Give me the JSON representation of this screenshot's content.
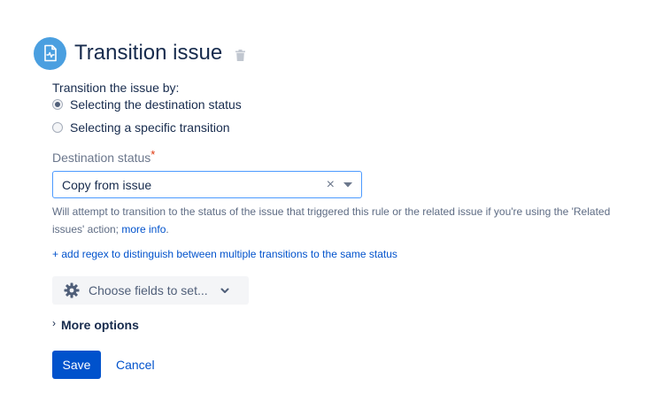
{
  "header": {
    "title": "Transition issue",
    "icon": "issue-transition-icon",
    "delete_icon": "trash-icon",
    "icon_color": "#4a9fe0"
  },
  "transition_by": {
    "label": "Transition the issue by:",
    "options": [
      {
        "label": "Selecting the destination status",
        "selected": true
      },
      {
        "label": "Selecting a specific transition",
        "selected": false
      }
    ]
  },
  "destination": {
    "label": "Destination status",
    "required_mark": "*",
    "value": "Copy from issue",
    "clear_icon": "×",
    "helper_text": "Will attempt to transition to the status of the issue that triggered this rule or the related issue if you're using the 'Related issues' action;",
    "helper_link": "more info",
    "helper_end": "."
  },
  "regex_link": "+ add regex to distinguish between multiple transitions to the same status",
  "fields_button": {
    "label": "Choose fields to set...",
    "icon": "gear-icon"
  },
  "more_options": {
    "label": "More options"
  },
  "actions": {
    "save": "Save",
    "cancel": "Cancel",
    "primary_color": "#0052cc"
  }
}
